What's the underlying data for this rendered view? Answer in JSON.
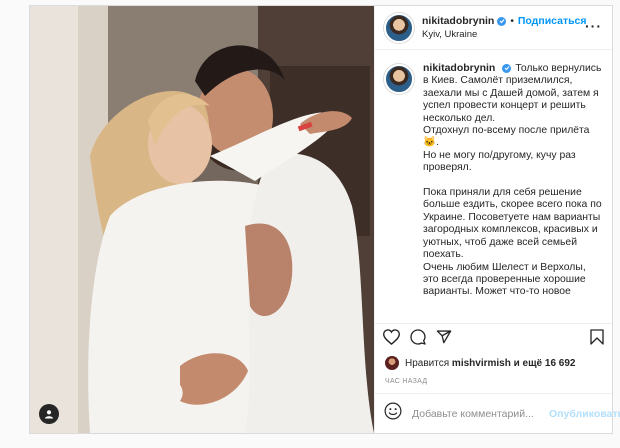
{
  "post": {
    "username": "nikitadobrynin",
    "follow_label": "Подписаться",
    "location": "Kyiv, Ukraine",
    "more_icon": "more-horizontal-icon",
    "tag_icon": "user-tag-icon"
  },
  "caption": {
    "username": "nikitadobrynin",
    "text": "Только вернулись в Киев. Самолёт приземлился, заехали мы с Дашей домой, затем я успел провести концерт и решить несколько дел.\nОтдохнул по-всему после прилёта 🐱.\nНо не могу по/другому, кучу раз проверял.\n\nПока приняли для себя решение больше ездить, скорее всего пока по Украине. Посоветуете нам варианты загородных комплексов, красивых и уютных, чтоб даже всей семьей поехать.\nОчень любим Шелест и Верхолы, это всегда проверенные хорошие варианты. Может что-то новое"
  },
  "actions": {
    "like_icon": "heart-icon",
    "comment_icon": "comment-icon",
    "share_icon": "share-icon",
    "save_icon": "bookmark-icon"
  },
  "likes": {
    "prefix": "Нравится",
    "user": "mishvirmish",
    "suffix": "и ещё 16 692"
  },
  "time_ago": "ЧАС НАЗАД",
  "comment_box": {
    "placeholder": "Добавьте комментарий...",
    "publish_label": "Опубликовать",
    "emoji_icon": "emoji-icon"
  },
  "colors": {
    "link": "#0095f6",
    "publish_disabled": "#b2dffc",
    "verified": "#3897f0"
  }
}
